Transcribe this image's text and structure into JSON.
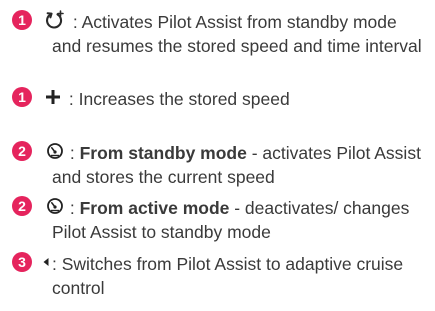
{
  "brand_color": "#e5245d",
  "items": [
    {
      "number": "1",
      "icon": "resume-icon",
      "separator": " : ",
      "bold": "",
      "text": "Activates Pilot Assist from standby mode and resumes the stored speed and time interval"
    },
    {
      "number": "1",
      "icon": "plus-icon",
      "separator": " : ",
      "bold": "",
      "text": "Increases the stored speed"
    },
    {
      "number": "2",
      "icon": "speedometer-icon",
      "separator": " : ",
      "bold": "From standby mode",
      "text": " - activates Pilot Assist and stores the current speed"
    },
    {
      "number": "2",
      "icon": "speedometer-icon",
      "separator": " : ",
      "bold": "From active mode",
      "text": " - deactivates/ changes Pilot Assist to standby mode"
    },
    {
      "number": "3",
      "icon": "arrow-left-icon",
      "separator": ": ",
      "bold": "",
      "text": "Switches from Pilot Assist to adaptive cruise control"
    }
  ]
}
